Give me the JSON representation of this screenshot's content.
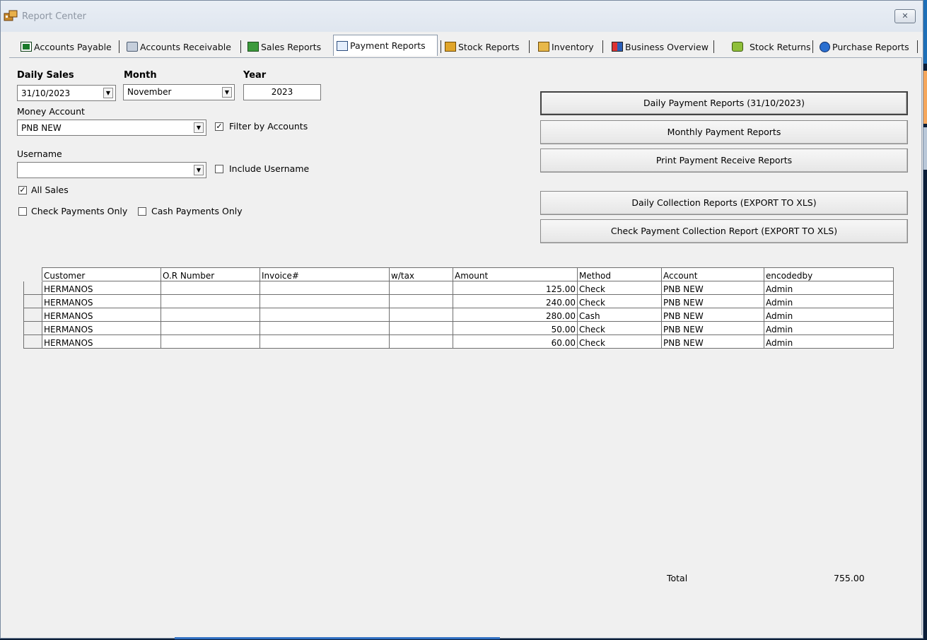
{
  "window": {
    "title": "Report Center",
    "close_glyph": "✕"
  },
  "tabs": [
    {
      "label": "Accounts Payable",
      "icon": "ledger-icon"
    },
    {
      "label": "Accounts Receivable",
      "icon": "database-icon"
    },
    {
      "label": "Sales Reports",
      "icon": "money-icon"
    },
    {
      "label": "Payment Reports",
      "icon": "report-icon"
    },
    {
      "label": "Stock Reports",
      "icon": "box-icon"
    },
    {
      "label": "Inventory",
      "icon": "box-icon"
    },
    {
      "label": "Business Overview",
      "icon": "grid-icon"
    },
    {
      "label": "Stock Returns",
      "icon": "return-icon"
    },
    {
      "label": "Purchase Reports",
      "icon": "globe-icon"
    }
  ],
  "filters": {
    "daily_sales_label": "Daily Sales",
    "daily_sales_value": "31/10/2023",
    "month_label": "Month",
    "month_value": "November",
    "year_label": "Year",
    "year_value": "2023",
    "money_account_label": "Money Account",
    "money_account_value": "PNB NEW",
    "filter_by_accounts_label": "Filter by Accounts",
    "filter_by_accounts_checked": "✓",
    "username_label": "Username",
    "username_value": "",
    "include_username_label": "Include Username",
    "all_sales_label": "All Sales",
    "all_sales_checked": "✓",
    "check_only_label": "Check Payments Only",
    "cash_only_label": "Cash Payments Only"
  },
  "actions": {
    "daily_payment": "Daily Payment Reports (31/10/2023)",
    "monthly_payment": "Monthly Payment Reports",
    "print_receive": "Print Payment Receive Reports",
    "daily_collection": "Daily Collection Reports (EXPORT TO XLS)",
    "check_collection": "Check Payment Collection Report (EXPORT TO XLS)"
  },
  "table": {
    "columns": [
      "Customer",
      "O.R Number",
      "Invoice#",
      "w/tax",
      "Amount",
      "Method",
      "Account",
      "encodedby"
    ],
    "rows": [
      [
        "HERMANOS",
        "",
        "",
        "",
        "125.00",
        "Check",
        "PNB NEW",
        "Admin"
      ],
      [
        "HERMANOS",
        "",
        "",
        "",
        "240.00",
        "Check",
        "PNB NEW",
        "Admin"
      ],
      [
        "HERMANOS",
        "",
        "",
        "",
        "280.00",
        "Cash",
        "PNB NEW",
        "Admin"
      ],
      [
        "HERMANOS",
        "",
        "",
        "",
        "50.00",
        "Check",
        "PNB NEW",
        "Admin"
      ],
      [
        "HERMANOS",
        "",
        "",
        "",
        "60.00",
        "Check",
        "PNB NEW",
        "Admin"
      ]
    ]
  },
  "totals": {
    "label": "Total",
    "value": "755.00"
  },
  "colors": {
    "accent_orange": "#f5a65b",
    "desktop": "#0c1e38"
  }
}
